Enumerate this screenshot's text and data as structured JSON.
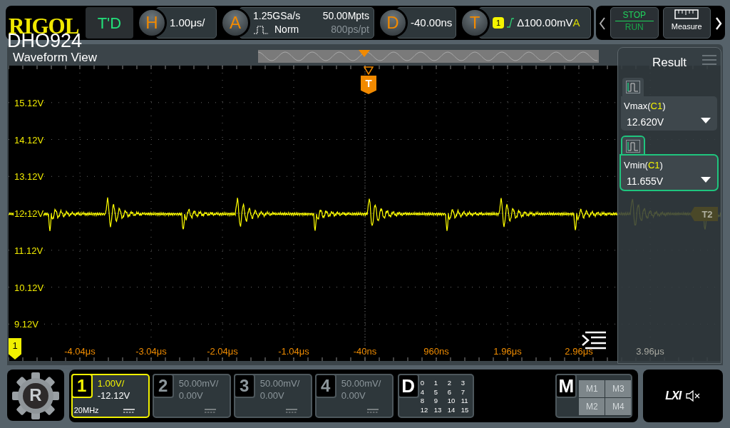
{
  "header": {
    "logo": "RIGOL",
    "model": "DHO924",
    "mode_button": "T'D"
  },
  "horizontal": {
    "letter": "H",
    "scale": "1.00μs/"
  },
  "acquire": {
    "letter": "A",
    "sample_rate": "1.25GSa/s",
    "mode": "Norm",
    "memory_depth": "50.00Mpts",
    "sample_interval": "800ps/pt"
  },
  "delay": {
    "letter": "D",
    "offset": "-40.00ns"
  },
  "trigger": {
    "letter": "T",
    "source": "1",
    "level": "Δ100.00mV",
    "sweep": "A"
  },
  "run_control": {
    "stop": "STOP",
    "run": "RUN"
  },
  "measure_button": {
    "label": "Measure"
  },
  "waveform_view": {
    "title": "Waveform View",
    "trigger_marker": "T",
    "channel_marker": "1",
    "cursor_marker": "T2",
    "y_labels": [
      "15.12V",
      "14.12V",
      "13.12V",
      "12.12V",
      "11.12V",
      "10.12V",
      "9.12V"
    ],
    "x_labels": [
      "-4.04μs",
      "-3.04μs",
      "-2.04μs",
      "-1.04μs",
      "-40ns",
      "960ns",
      "1.96μs",
      "2.96μs",
      "3.96μs"
    ]
  },
  "result": {
    "title": "Result",
    "items": [
      {
        "label": [
          "Vmax(",
          "C1",
          ")"
        ],
        "value": "12.620V",
        "selected": false
      },
      {
        "label": [
          "Vmin(",
          "C1",
          ")"
        ],
        "value": "11.655V",
        "selected": true
      }
    ]
  },
  "app_button": {
    "letter": "R"
  },
  "channels": [
    {
      "number": "1",
      "scale": "1.00V/",
      "offset": "-12.12V",
      "bandwidth": "20MHz",
      "on": true
    },
    {
      "number": "2",
      "scale": "50.00mV/",
      "offset": "0.00V",
      "on": false
    },
    {
      "number": "3",
      "scale": "50.00mV/",
      "offset": "0.00V",
      "on": false
    },
    {
      "number": "4",
      "scale": "50.00mV/",
      "offset": "0.00V",
      "on": false
    }
  ],
  "digital": {
    "letter": "D",
    "bits": [
      "0",
      "1",
      "2",
      "3",
      "4",
      "5",
      "6",
      "7",
      "8",
      "9",
      "10",
      "11",
      "12",
      "13",
      "14",
      "15"
    ]
  },
  "math": {
    "letter": "M",
    "items": [
      "M1",
      "M3",
      "M2",
      "M4"
    ]
  },
  "status": {
    "lxi": "LXI"
  }
}
